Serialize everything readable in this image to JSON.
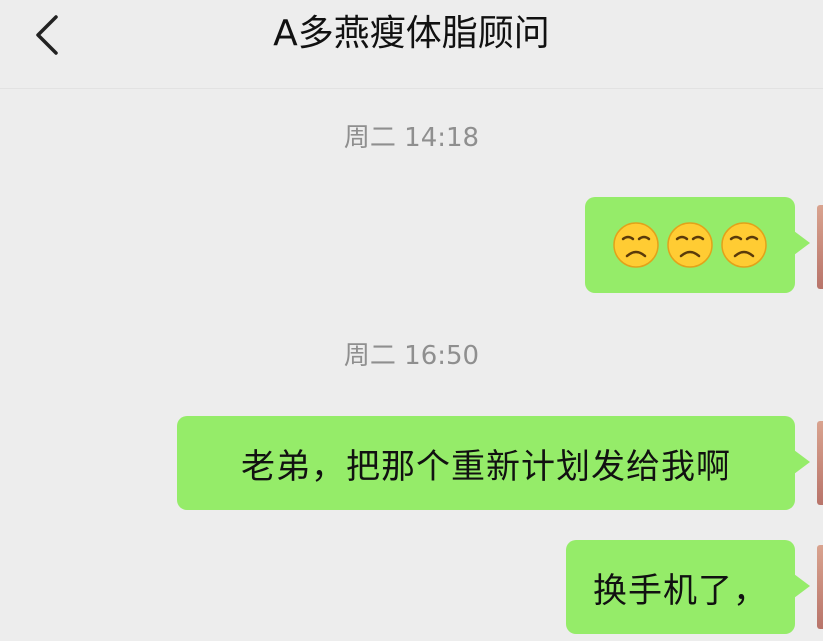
{
  "header": {
    "title": "A多燕瘦体脂顾问",
    "back_icon": "chevron-left-icon"
  },
  "messages": [
    {
      "type": "timestamp",
      "text": "周二 14:18"
    },
    {
      "type": "sent_emoji",
      "emoji_names": [
        "sad-face-icon",
        "sad-face-icon",
        "sad-face-icon"
      ],
      "emoji_text": "😞😞😞"
    },
    {
      "type": "timestamp",
      "text": "周二 16:50"
    },
    {
      "type": "sent_text",
      "text": "老弟，把那个重新计划发给我啊"
    },
    {
      "type": "sent_text",
      "text": "换手机了，"
    }
  ],
  "colors": {
    "background": "#ededed",
    "bubble_sent": "#95ec69",
    "timestamp": "#8f8f8f",
    "emoji_face": "#ffcc33"
  }
}
